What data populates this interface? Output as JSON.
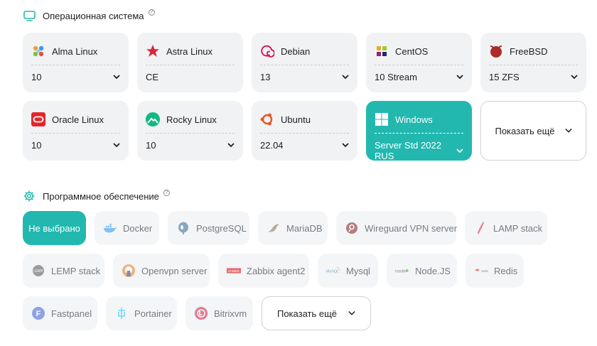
{
  "os_section": {
    "title": "Операционная система",
    "help": "?",
    "cards": [
      {
        "name": "Alma Linux",
        "version": "10",
        "icon": "almalinux-icon"
      },
      {
        "name": "Astra Linux",
        "version": "CE",
        "icon": "astralinux-icon"
      },
      {
        "name": "Debian",
        "version": "13",
        "icon": "debian-icon"
      },
      {
        "name": "CentOS",
        "version": "10 Stream",
        "icon": "centos-icon"
      },
      {
        "name": "FreeBSD",
        "version": "15 ZFS",
        "icon": "freebsd-icon"
      },
      {
        "name": "Oracle Linux",
        "version": "10",
        "icon": "oracle-icon"
      },
      {
        "name": "Rocky Linux",
        "version": "10",
        "icon": "rocky-icon"
      },
      {
        "name": "Ubuntu",
        "version": "22.04",
        "icon": "ubuntu-icon"
      },
      {
        "name": "Windows",
        "version": "Server Std 2022 RUS",
        "icon": "windows-icon",
        "selected": true
      }
    ],
    "show_more": "Показать ещё"
  },
  "software_section": {
    "title": "Программное обеспечение",
    "help": "?",
    "items": [
      {
        "label": "Не выбрано",
        "selected": true
      },
      {
        "label": "Docker",
        "icon": "docker-icon"
      },
      {
        "label": "PostgreSQL",
        "icon": "postgresql-icon"
      },
      {
        "label": "MariaDB",
        "icon": "mariadb-icon"
      },
      {
        "label": "Wireguard VPN server",
        "icon": "wireguard-icon"
      },
      {
        "label": "LAMP stack",
        "icon": "lamp-icon"
      },
      {
        "label": "LEMP stack",
        "icon": "lemp-icon"
      },
      {
        "label": "Openvpn server",
        "icon": "openvpn-icon"
      },
      {
        "label": "Zabbix agent2",
        "icon": "zabbix-icon"
      },
      {
        "label": "Mysql",
        "icon": "mysql-icon"
      },
      {
        "label": "Node.JS",
        "icon": "nodejs-icon"
      },
      {
        "label": "Redis",
        "icon": "redis-icon"
      },
      {
        "label": "Fastpanel",
        "icon": "fastpanel-icon"
      },
      {
        "label": "Portainer",
        "icon": "portainer-icon"
      },
      {
        "label": "Bitrixvm",
        "icon": "bitrix-icon"
      }
    ],
    "show_more": "Показать ещё"
  },
  "colors": {
    "accent": "#22b8b0",
    "card_bg": "#f1f2f4",
    "chip_bg": "#f4f5f7"
  }
}
